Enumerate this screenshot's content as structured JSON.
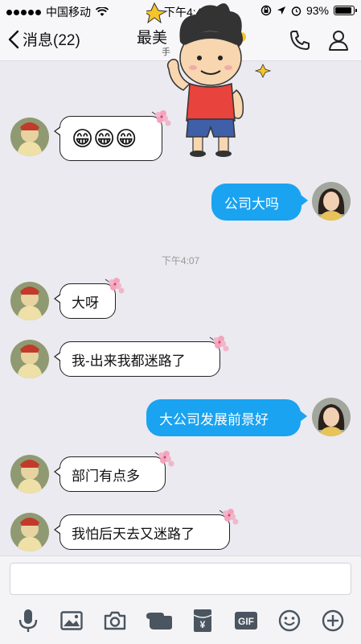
{
  "status": {
    "carrier": "中国移动",
    "time": "下午4:4",
    "battery": "93%",
    "battery_level": 0.93
  },
  "nav": {
    "back_label": "消息(22)",
    "title": "最美",
    "subtitle": "手"
  },
  "timestamp": "下午4:07",
  "messages": [
    {
      "side": "in",
      "text": "😁😁😁"
    },
    {
      "side": "out",
      "text": "公司大吗"
    },
    {
      "side": "in",
      "text": "大呀"
    },
    {
      "side": "in",
      "text": "我-出来我都迷路了"
    },
    {
      "side": "out",
      "text": "大公司发展前景好"
    },
    {
      "side": "in",
      "text": "部门有点多"
    },
    {
      "side": "in",
      "text": "我怕后天去又迷路了"
    }
  ],
  "toolbar": {
    "gif_label": "GIF",
    "yen_label": "¥",
    "icons": [
      "microphone-icon",
      "image-icon",
      "camera-icon",
      "poke-icon",
      "red-packet-icon",
      "gif-icon",
      "emoji-icon",
      "plus-icon"
    ]
  },
  "colors": {
    "accent": "#1aa3f0",
    "background": "#eaeaf0",
    "toolbar_icon": "#4a5560"
  }
}
